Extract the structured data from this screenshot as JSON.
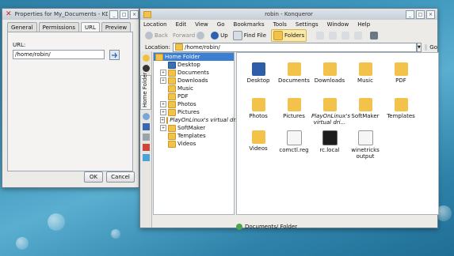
{
  "properties": {
    "title": "Properties for My_Documents - KDesk",
    "tabs": [
      "General",
      "Permissions",
      "URL",
      "Preview"
    ],
    "url_label": "URL:",
    "url_value": "/home/robin/",
    "ok": "OK",
    "cancel": "Cancel"
  },
  "konqueror": {
    "title": "robin - Konqueror",
    "menu": [
      "Location",
      "Edit",
      "View",
      "Go",
      "Bookmarks",
      "Tools",
      "Settings",
      "Window",
      "Help"
    ],
    "toolbar": {
      "back": "Back",
      "forward": "Forward",
      "up": "Up",
      "find_file": "Find File",
      "folders": "Folders"
    },
    "location_label": "Location:",
    "location_value": "/home/robin/",
    "go_label": "Go",
    "sidebar_tab": "Home Folder",
    "tree": [
      {
        "label": "Home Folder",
        "selected": true,
        "expander": ""
      },
      {
        "label": "Desktop",
        "expander": ""
      },
      {
        "label": "Documents",
        "expander": "+"
      },
      {
        "label": "Downloads",
        "expander": "+"
      },
      {
        "label": "Music",
        "expander": ""
      },
      {
        "label": "PDF",
        "expander": ""
      },
      {
        "label": "Photos",
        "expander": "+"
      },
      {
        "label": "Pictures",
        "expander": "+"
      },
      {
        "label": "PlayOnLinux's virtual drives",
        "expander": "+"
      },
      {
        "label": "SoftMaker",
        "expander": "+"
      },
      {
        "label": "Templates",
        "expander": ""
      },
      {
        "label": "Videos",
        "expander": ""
      }
    ],
    "files": [
      {
        "name": "Desktop",
        "icon": "desktop-icon"
      },
      {
        "name": "Documents",
        "icon": "folder-documents-icon"
      },
      {
        "name": "Downloads",
        "icon": "folder-downloads-icon"
      },
      {
        "name": "Music",
        "icon": "folder-music-icon"
      },
      {
        "name": "PDF",
        "icon": "folder-icon"
      },
      {
        "name": "Photos",
        "icon": "folder-icon"
      },
      {
        "name": "Pictures",
        "icon": "folder-pictures-icon"
      },
      {
        "name": "PlayOnLinux's virtual dri...",
        "icon": "folder-icon"
      },
      {
        "name": "SoftMaker",
        "icon": "folder-icon"
      },
      {
        "name": "Templates",
        "icon": "folder-icon"
      },
      {
        "name": "Videos",
        "icon": "folder-videos-icon"
      },
      {
        "name": "comctl.reg",
        "icon": "document-icon"
      },
      {
        "name": "rc.local",
        "icon": "script-icon"
      },
      {
        "name": "winetricks output",
        "icon": "document-icon"
      }
    ],
    "status": "Documents/  Folder"
  }
}
